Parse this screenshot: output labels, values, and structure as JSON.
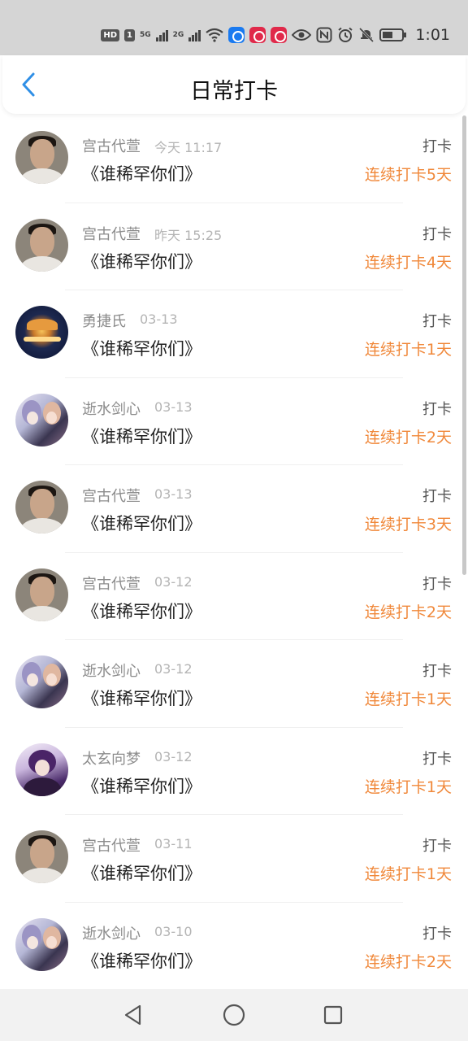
{
  "status_bar": {
    "badge_hd": "HD",
    "badge_1": "1",
    "net1": "5G",
    "net2": "2G",
    "time": "1:01"
  },
  "header": {
    "title": "日常打卡",
    "back_icon": "chevron-left-icon"
  },
  "colors": {
    "accent": "#2f8fe6",
    "streak": "#f0883a"
  },
  "rows": [
    {
      "avatar": "boy",
      "name": "宫古代萱",
      "time": "今天 11:17",
      "book": "《谁稀罕你们》",
      "action": "打卡",
      "streak": "连续打卡5天"
    },
    {
      "avatar": "boy",
      "name": "宫古代萱",
      "time": "昨天 15:25",
      "book": "《谁稀罕你们》",
      "action": "打卡",
      "streak": "连续打卡4天"
    },
    {
      "avatar": "carousel",
      "name": "勇捷氏",
      "time": "03-13",
      "book": "《谁稀罕你们》",
      "action": "打卡",
      "streak": "连续打卡1天"
    },
    {
      "avatar": "anime",
      "name": "逝水剑心",
      "time": "03-13",
      "book": "《谁稀罕你们》",
      "action": "打卡",
      "streak": "连续打卡2天"
    },
    {
      "avatar": "boy",
      "name": "宫古代萱",
      "time": "03-13",
      "book": "《谁稀罕你们》",
      "action": "打卡",
      "streak": "连续打卡3天"
    },
    {
      "avatar": "boy",
      "name": "宫古代萱",
      "time": "03-12",
      "book": "《谁稀罕你们》",
      "action": "打卡",
      "streak": "连续打卡2天"
    },
    {
      "avatar": "anime",
      "name": "逝水剑心",
      "time": "03-12",
      "book": "《谁稀罕你们》",
      "action": "打卡",
      "streak": "连续打卡1天"
    },
    {
      "avatar": "purple",
      "name": "太玄向梦",
      "time": "03-12",
      "book": "《谁稀罕你们》",
      "action": "打卡",
      "streak": "连续打卡1天"
    },
    {
      "avatar": "boy",
      "name": "宫古代萱",
      "time": "03-11",
      "book": "《谁稀罕你们》",
      "action": "打卡",
      "streak": "连续打卡1天"
    },
    {
      "avatar": "anime",
      "name": "逝水剑心",
      "time": "03-10",
      "book": "《谁稀罕你们》",
      "action": "打卡",
      "streak": "连续打卡2天"
    }
  ],
  "nav": {
    "back": "triangle-back-icon",
    "home": "circle-home-icon",
    "recent": "square-recent-icon"
  }
}
